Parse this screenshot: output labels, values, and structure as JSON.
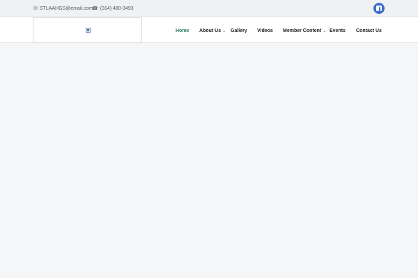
{
  "topbar": {
    "email": {
      "icon": "envelope-icon",
      "text": "STLAAHGS@email.com"
    },
    "phone": {
      "icon": "phone-icon",
      "text": "(314) 480-3493"
    },
    "social": {
      "icon": "facebook-icon",
      "color": "#3d6ec9"
    }
  },
  "header": {
    "logo": {
      "icon": "broken-image-icon"
    },
    "nav": [
      {
        "label": "Home",
        "active": true
      },
      {
        "label": "About Us",
        "has_dropdown": true
      },
      {
        "label": "Gallery"
      },
      {
        "label": "Videos"
      },
      {
        "label": "Member Content",
        "has_dropdown": true
      },
      {
        "label": "Events"
      },
      {
        "label": "Contact Us"
      }
    ],
    "active_color": "#2f7a5c"
  }
}
